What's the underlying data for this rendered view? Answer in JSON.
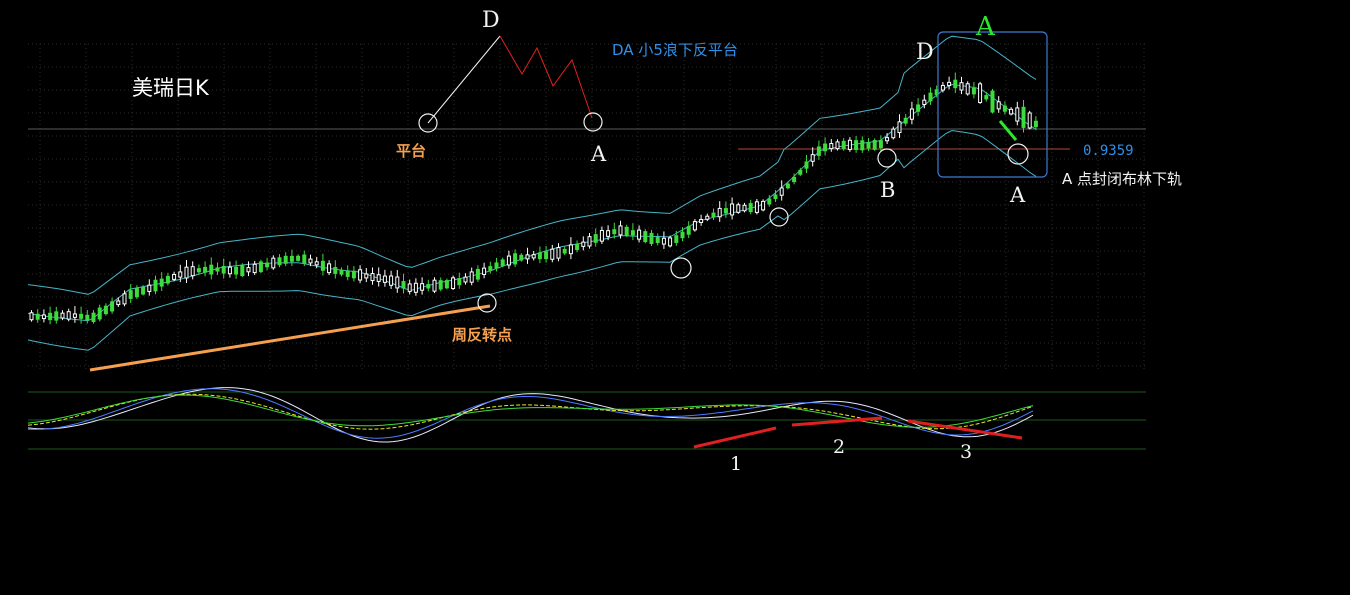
{
  "chart_data": {
    "type": "candlestick",
    "title": "美瑞日K",
    "price_level": {
      "value": "0.9359",
      "color": "#2e8fe6"
    },
    "colors": {
      "up": "#ffffff",
      "down": "#3cdc3c",
      "bollinger": "#46b4c8",
      "grid": "#1b5a1b",
      "divergence_lines": "#e02020",
      "weekly_line": "#f5a050",
      "box": "#3f79d0"
    },
    "candles": [],
    "annotations": {
      "sketch_D": "D",
      "sketch_A": "A",
      "sketch_platform": "平台",
      "sketch_caption": "DA 小5浪下反平台",
      "weekly_reversal": "周反转点",
      "label_B": "B",
      "label_D": "D",
      "label_A_top": "A",
      "label_A_bottom": "A",
      "caption_A": "A 点封闭布林下轨",
      "div_1": "1",
      "div_2": "2",
      "div_3": "3"
    }
  }
}
